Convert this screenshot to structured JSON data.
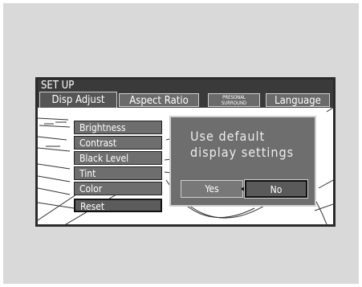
{
  "window": {
    "title": "SET UP"
  },
  "tabs": [
    {
      "label": "Disp Adjust",
      "active": true
    },
    {
      "label": "Aspect Ratio",
      "active": false
    },
    {
      "label_line1": "PRESONAL",
      "label_line2": "SURROUND",
      "active": false
    },
    {
      "label": "Language",
      "active": false
    }
  ],
  "menu": {
    "items": [
      "Brightness",
      "Contrast",
      "Black Level",
      "Tint",
      "Color",
      "Reset"
    ],
    "selected": "Reset"
  },
  "dialog": {
    "message": "Use default\ndisplay settings",
    "yes_label": "Yes",
    "no_label": "No",
    "selected": "No"
  },
  "colors": {
    "background": "#d9d9d9",
    "screen_bezel": "#2b2b2b",
    "button_gray": "#6e6e6e"
  }
}
